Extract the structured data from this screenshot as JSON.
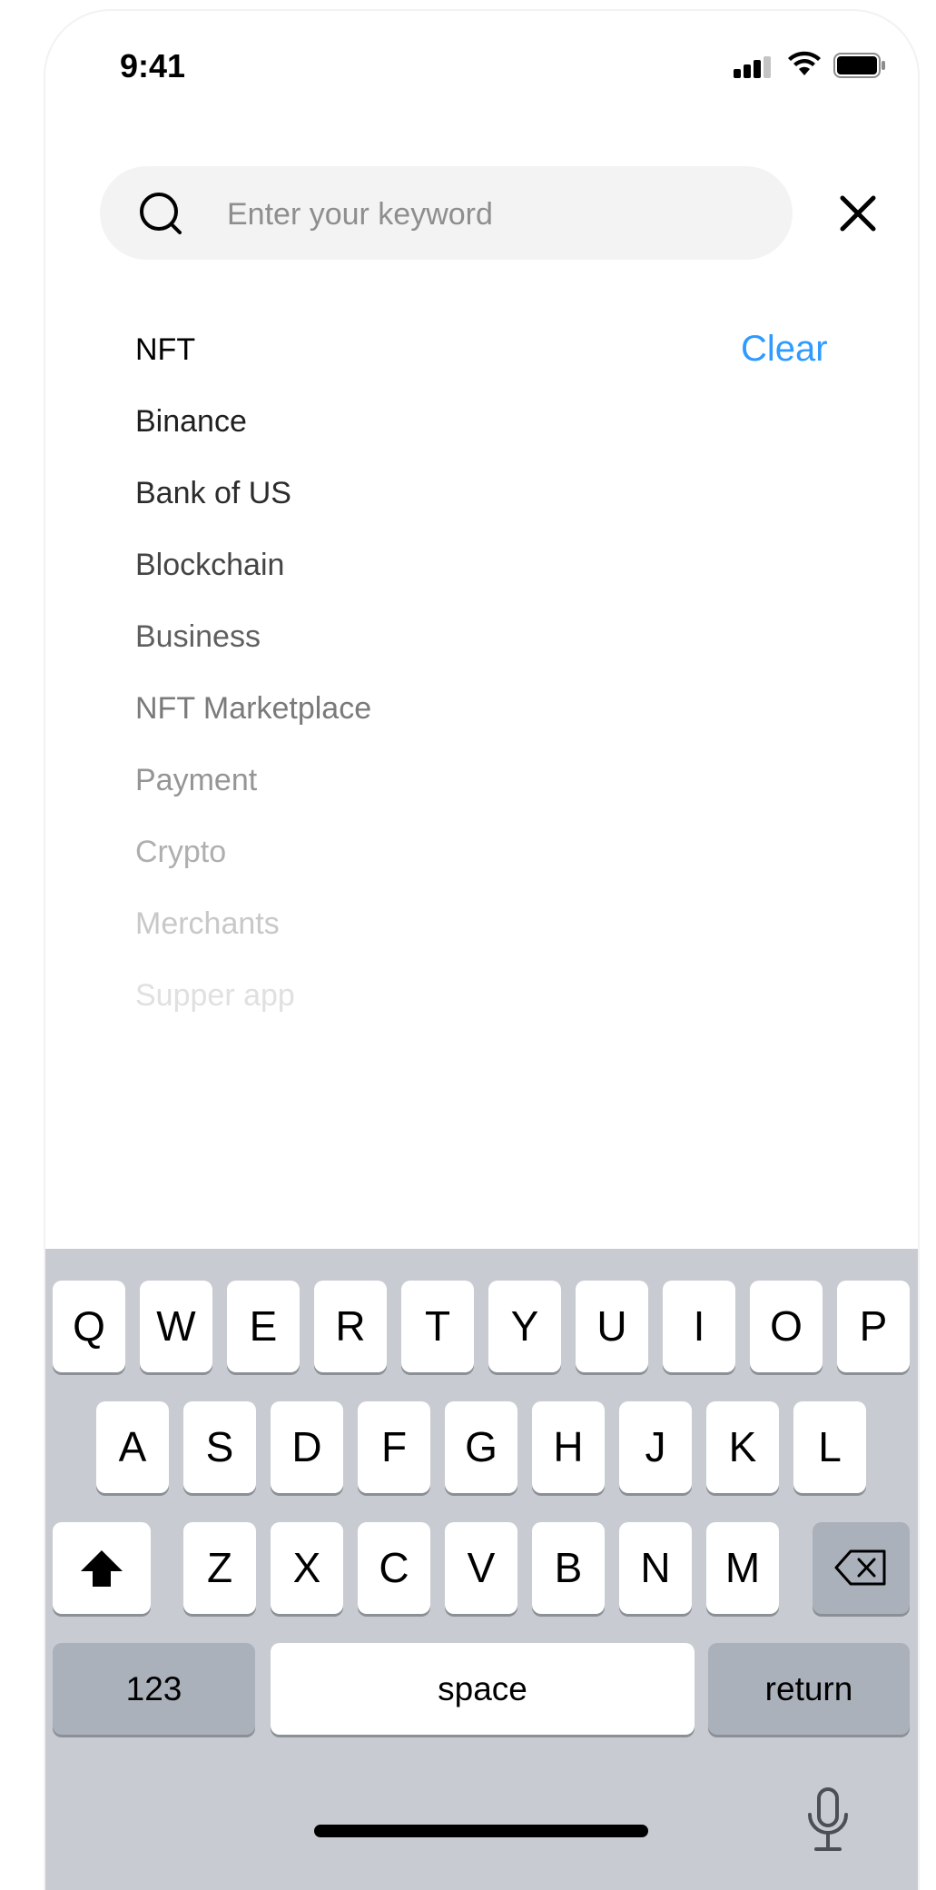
{
  "status_bar": {
    "time": "9:41"
  },
  "search": {
    "placeholder": "Enter your keyword",
    "value": ""
  },
  "history": {
    "clear_label": "Clear",
    "items": [
      "NFT",
      "Binance",
      "Bank of US",
      "Blockchain",
      "Business",
      "NFT Marketplace",
      "Payment",
      "Crypto",
      "Merchants",
      "Supper app"
    ]
  },
  "keyboard": {
    "row1": [
      "Q",
      "W",
      "E",
      "R",
      "T",
      "Y",
      "U",
      "I",
      "O",
      "P"
    ],
    "row2": [
      "A",
      "S",
      "D",
      "F",
      "G",
      "H",
      "J",
      "K",
      "L"
    ],
    "row3": [
      "Z",
      "X",
      "C",
      "V",
      "B",
      "N",
      "M"
    ],
    "numbers_label": "123",
    "space_label": "space",
    "return_label": "return"
  },
  "colors": {
    "accent": "#2f9bff",
    "keyboard_bg": "#c8cbd1",
    "key_dark": "#abb1bb"
  },
  "icons": [
    "signal-icon",
    "wifi-icon",
    "battery-icon",
    "search-icon",
    "close-icon",
    "shift-icon",
    "backspace-icon",
    "microphone-icon"
  ]
}
